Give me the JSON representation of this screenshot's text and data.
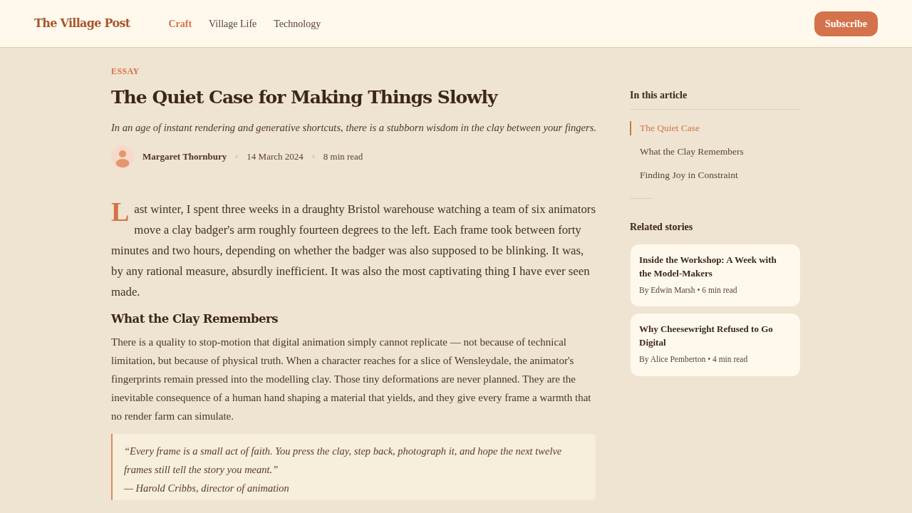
{
  "navbar": {
    "brand": "The Village Post",
    "links": [
      {
        "label": "Craft",
        "selected": true
      },
      {
        "label": "Village Life",
        "selected": false
      },
      {
        "label": "Technology",
        "selected": false
      }
    ],
    "subscribe": "Subscribe"
  },
  "article": {
    "category": "ESSAY",
    "title": "The Quiet Case for Making Things Slowly",
    "deck": "In an age of instant rendering and generative shortcuts, there is a stubborn wisdom in the clay between your fingers.",
    "byline": {
      "author": "Margaret Thornbury",
      "date": "14 March 2024",
      "read_time": "8 min read"
    },
    "body": [
      {
        "kind": "paragraph",
        "drop_cap": true,
        "text": "Last winter, I spent three weeks in a draughty Bristol warehouse watching a team of six animators move a clay badger's arm roughly fourteen degrees to the left. Each frame took between forty minutes and two hours, depending on whether the badger was also supposed to be blinking. It was, by any rational measure, absurdly inefficient. It was also the most captivating thing I have ever seen made."
      },
      {
        "kind": "heading",
        "text": "What the Clay Remembers"
      },
      {
        "kind": "paragraph",
        "drop_cap": false,
        "text": "There is a quality to stop-motion that digital animation simply cannot replicate — not because of technical limitation, but because of physical truth. When a character reaches for a slice of Wensleydale, the animator's fingerprints remain pressed into the modelling clay. Those tiny deformations are never planned. They are the inevitable consequence of a human hand shaping a material that yields, and they give every frame a warmth that no render farm can simulate."
      },
      {
        "kind": "quote",
        "text": "“Every frame is a small act of faith. You press the clay, step back, photograph it, and hope the next twelve frames still tell the story you meant.”",
        "attribution": "— Harold Cribbs, director of animation"
      }
    ]
  },
  "sidebar": {
    "toc": {
      "title": "In this article",
      "items": [
        {
          "label": "The Quiet Case",
          "selected": true
        },
        {
          "label": "What the Clay Remembers",
          "selected": false
        },
        {
          "label": "Finding Joy in Constraint",
          "selected": false
        }
      ]
    },
    "related": {
      "title": "Related stories",
      "stories": [
        {
          "title": "Inside the Workshop: A Week with the Model-Makers",
          "meta": "By Edwin Marsh • 6 min read"
        },
        {
          "title": "Why Cheesewright Refused to Go Digital",
          "meta": "By Alice Pemberton • 4 min read"
        }
      ]
    }
  }
}
